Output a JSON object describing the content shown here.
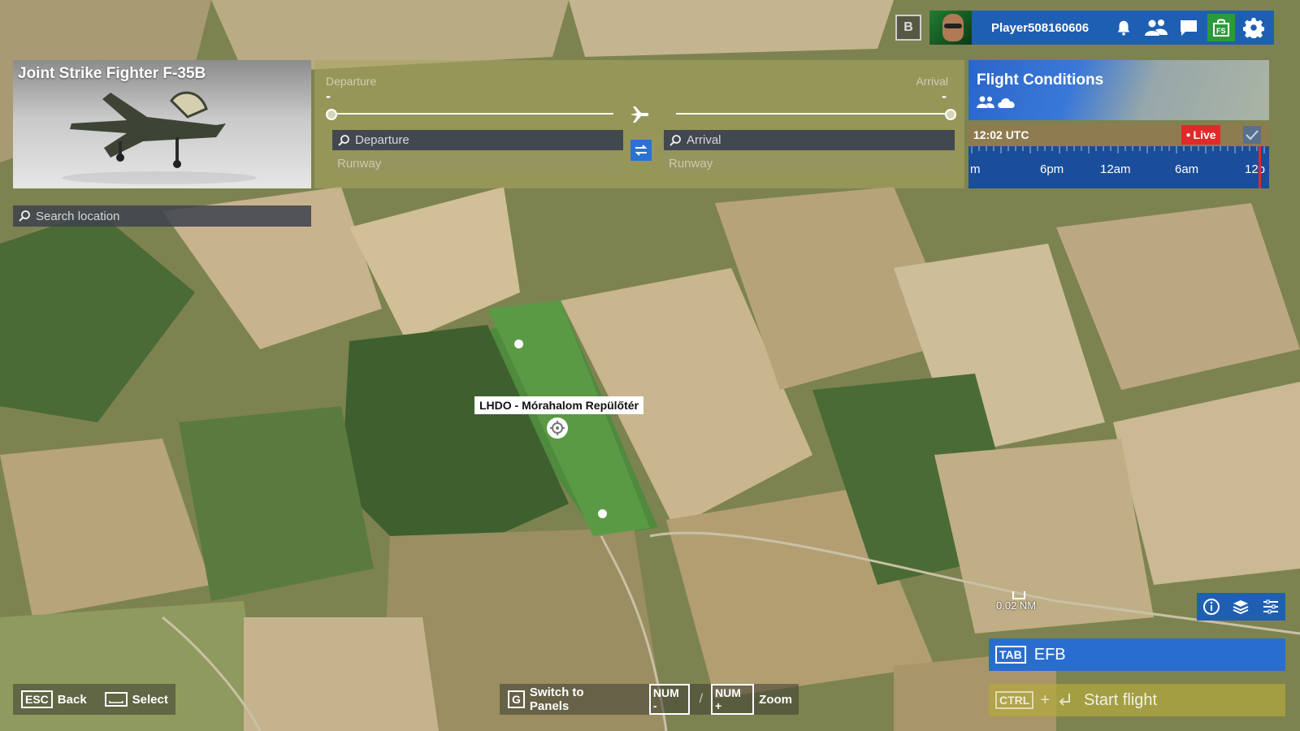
{
  "topbar": {
    "badge": "B",
    "player_name": "Player508160606",
    "icons": [
      "bell-icon",
      "friends-icon",
      "chat-icon",
      "shop-icon",
      "settings-icon"
    ]
  },
  "aircraft": {
    "name": "Joint Strike Fighter F-35B"
  },
  "search_location": {
    "placeholder": "Search location"
  },
  "route": {
    "departure_label": "Departure",
    "arrival_label": "Arrival",
    "departure_value": "-",
    "arrival_value": "-",
    "departure_placeholder": "Departure",
    "arrival_placeholder": "Arrival",
    "runway_placeholder": "Runway"
  },
  "flight_conditions": {
    "title": "Flight Conditions",
    "time": "12:02 UTC",
    "live_label": "Live",
    "timeline_labels": [
      "m",
      "6pm",
      "12am",
      "6am",
      "12p"
    ]
  },
  "map": {
    "airport_label": "LHDO - Mórahalom Repülőtér",
    "scale_label": "0.02 NM"
  },
  "efb": {
    "key": "TAB",
    "label": "EFB"
  },
  "start_flight": {
    "key": "CTRL",
    "plus": "+",
    "label": "Start flight"
  },
  "hints": {
    "back_key": "ESC",
    "back_label": "Back",
    "select_label": "Select",
    "switch_key": "G",
    "switch_label": "Switch to Panels",
    "zoom_out_key": "NUM -",
    "zoom_in_key": "NUM +",
    "zoom_label": "Zoom",
    "slash": "/"
  },
  "colors": {
    "accent_blue": "#1f5fb3",
    "live_red": "#e02a2a",
    "shop_green": "#2d9a3a"
  }
}
